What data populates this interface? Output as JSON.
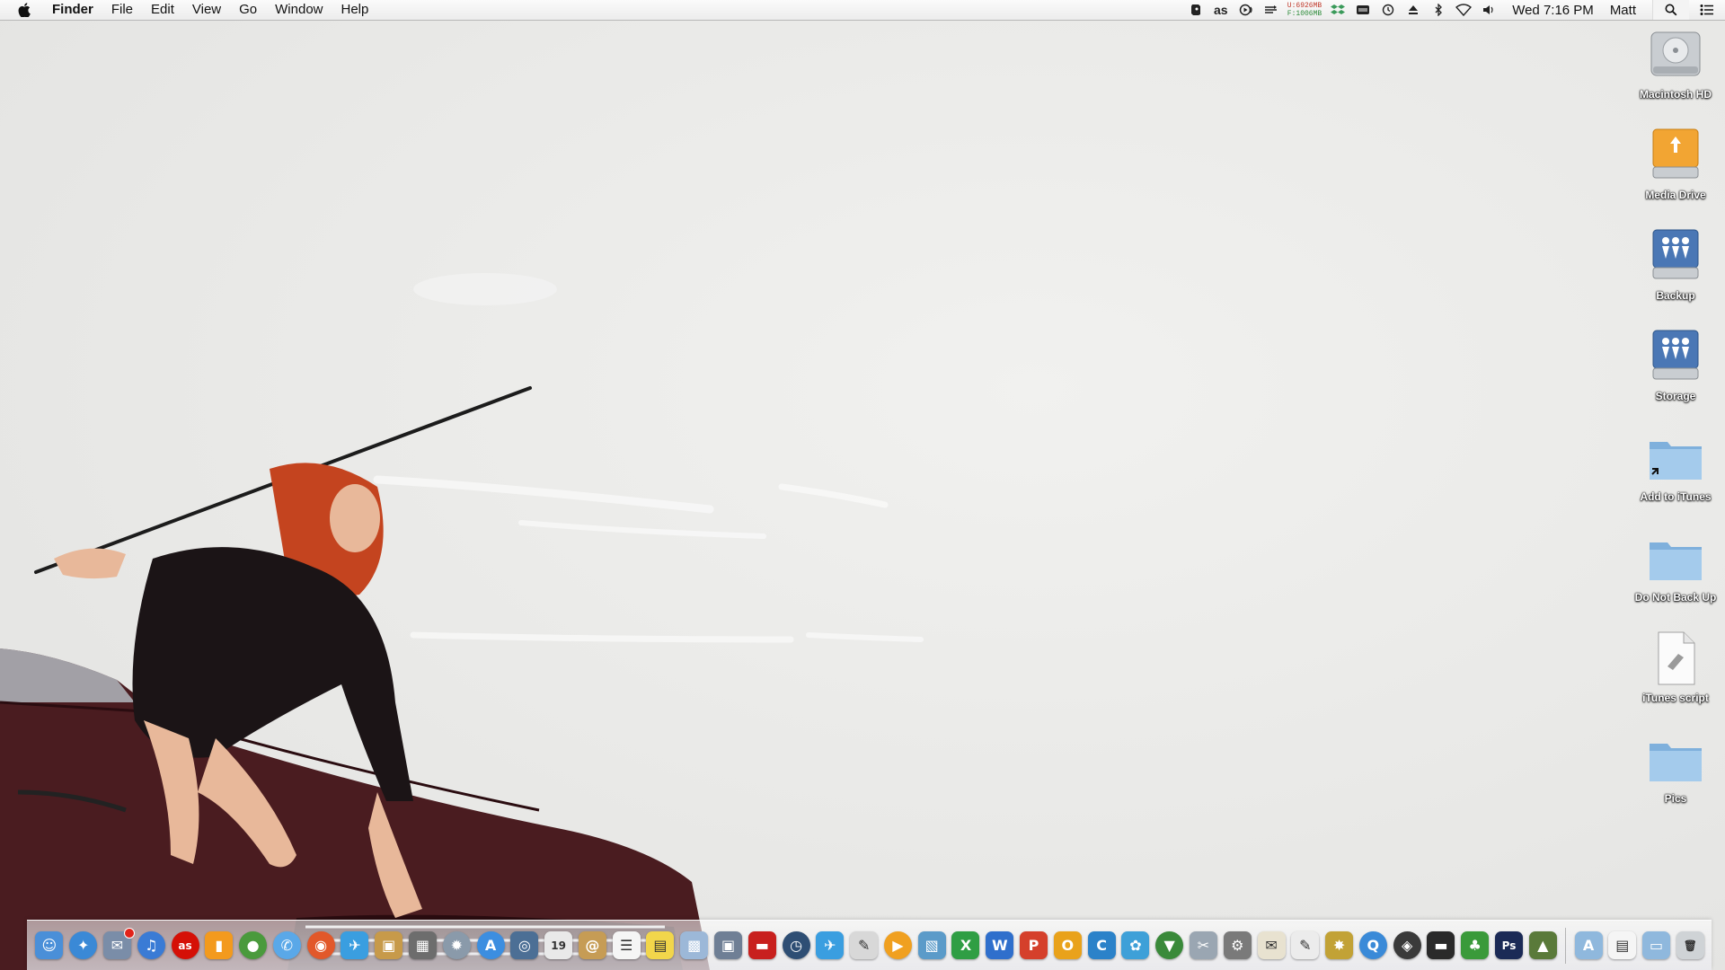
{
  "menubar": {
    "app_name": "Finder",
    "menus": [
      "File",
      "Edit",
      "View",
      "Go",
      "Window",
      "Help"
    ],
    "status": {
      "lastfm": "as",
      "memory_used": "U:6926MB",
      "memory_free": "F:1006MB",
      "clock": "Wed 7:16 PM",
      "user": "Matt"
    }
  },
  "desktop": {
    "icons": [
      {
        "label": "Macintosh HD",
        "icon": "hard-drive-icon"
      },
      {
        "label": "Media Drive",
        "icon": "firewire-drive-icon"
      },
      {
        "label": "Backup",
        "icon": "network-drive-icon"
      },
      {
        "label": "Storage",
        "icon": "network-drive-icon"
      },
      {
        "label": "Add to iTunes",
        "icon": "folder-alias-icon"
      },
      {
        "label": "Do Not Back Up",
        "icon": "folder-icon"
      },
      {
        "label": "iTunes script",
        "icon": "script-icon"
      },
      {
        "label": "Pics",
        "icon": "folder-icon"
      }
    ]
  },
  "dock": {
    "apps": [
      {
        "name": "finder",
        "glyph": "☺",
        "color": "#4a8fd8"
      },
      {
        "name": "safari",
        "glyph": "✦",
        "color": "#3a89d6",
        "round": true
      },
      {
        "name": "mail-stamp",
        "glyph": "✉",
        "color": "#7a8da8",
        "badge": true
      },
      {
        "name": "itunes",
        "glyph": "♫",
        "color": "#3a7bd5",
        "round": true
      },
      {
        "name": "lastfm",
        "glyph": "as",
        "color": "#d51007",
        "round": true
      },
      {
        "name": "ibooks",
        "glyph": "▮",
        "color": "#f39a1e"
      },
      {
        "name": "chrome",
        "glyph": "●",
        "color": "#4a9a3c",
        "round": true
      },
      {
        "name": "messages",
        "glyph": "✆",
        "color": "#5aa8e8",
        "round": true
      },
      {
        "name": "firefox",
        "glyph": "◉",
        "color": "#e2582a",
        "round": true
      },
      {
        "name": "twitter",
        "glyph": "✈",
        "color": "#3a9ee0"
      },
      {
        "name": "package",
        "glyph": "▣",
        "color": "#c79a4a"
      },
      {
        "name": "grid-app",
        "glyph": "▦",
        "color": "#6d6d6d"
      },
      {
        "name": "launchpad",
        "glyph": "✹",
        "color": "#8a9aaa",
        "round": true
      },
      {
        "name": "app-store",
        "glyph": "A",
        "color": "#3c8ee0",
        "round": true
      },
      {
        "name": "image-capture",
        "glyph": "◎",
        "color": "#4c6f95"
      },
      {
        "name": "calendar",
        "glyph": "19",
        "color": "#e9e9e9",
        "dark": true
      },
      {
        "name": "contacts",
        "glyph": "@",
        "color": "#c69c55"
      },
      {
        "name": "reminders",
        "glyph": "☰",
        "color": "#f5f5f5",
        "dark": true
      },
      {
        "name": "stickies",
        "glyph": "▤",
        "color": "#f2d64b",
        "dark": true
      },
      {
        "name": "preview",
        "glyph": "▩",
        "color": "#9cb8d8"
      },
      {
        "name": "photo-booth",
        "glyph": "▣",
        "color": "#6f7f95"
      },
      {
        "name": "flashcard",
        "glyph": "▬",
        "color": "#c8201e"
      },
      {
        "name": "time-machine",
        "glyph": "◷",
        "color": "#2e4e74",
        "round": true
      },
      {
        "name": "twitterrific",
        "glyph": "✈",
        "color": "#3a9ee0"
      },
      {
        "name": "script-editor",
        "glyph": "✎",
        "color": "#d8d8d8",
        "dark": true
      },
      {
        "name": "vlc",
        "glyph": "▶",
        "color": "#f0a020",
        "round": true
      },
      {
        "name": "preview-2",
        "glyph": "▧",
        "color": "#5b9bc9"
      },
      {
        "name": "excel",
        "glyph": "X",
        "color": "#2f9e44"
      },
      {
        "name": "word",
        "glyph": "W",
        "color": "#2f6fcc"
      },
      {
        "name": "powerpoint",
        "glyph": "P",
        "color": "#d5402b"
      },
      {
        "name": "outlook",
        "glyph": "O",
        "color": "#e9a21b"
      },
      {
        "name": "communicator",
        "glyph": "C",
        "color": "#2b82c9"
      },
      {
        "name": "messenger",
        "glyph": "✿",
        "color": "#3ea0d8"
      },
      {
        "name": "transmission",
        "glyph": "▼",
        "color": "#3a8a3a",
        "round": true
      },
      {
        "name": "utilities",
        "glyph": "✂",
        "color": "#9aa6b2"
      },
      {
        "name": "system-preferences",
        "glyph": "⚙",
        "color": "#7a7a7a"
      },
      {
        "name": "mail-relay",
        "glyph": "✉",
        "color": "#e8e2d0",
        "dark": true
      },
      {
        "name": "textedit",
        "glyph": "✎",
        "color": "#ececec",
        "dark": true
      },
      {
        "name": "pineapple",
        "glyph": "✸",
        "color": "#c2a236"
      },
      {
        "name": "quicktime",
        "glyph": "Q",
        "color": "#3a8ad8",
        "round": true
      },
      {
        "name": "dashboard",
        "glyph": "◈",
        "color": "#3a3a3a",
        "round": true
      },
      {
        "name": "ethernet",
        "glyph": "▬",
        "color": "#2a2a2a"
      },
      {
        "name": "evernote",
        "glyph": "♣",
        "color": "#3a9a3a"
      },
      {
        "name": "photoshop",
        "glyph": "Ps",
        "color": "#1b2a56"
      },
      {
        "name": "activity-monitor",
        "glyph": "▲",
        "color": "#5a7a3a"
      }
    ],
    "right": [
      {
        "name": "applications-folder",
        "glyph": "A",
        "color": "#8fb8dd"
      },
      {
        "name": "documents-stack",
        "glyph": "▤",
        "color": "#f5f5f5",
        "dark": true
      },
      {
        "name": "downloads-folder",
        "glyph": "▭",
        "color": "#8fb8dd"
      },
      {
        "name": "trash",
        "glyph": "🗑",
        "color": "#cfd3d6",
        "dark": true
      }
    ]
  },
  "colors": {
    "menubar_bg": "#f4f4f4",
    "wallpaper": "#e9e9e7",
    "car": "#4a1c20",
    "hair": "#c4441f",
    "folder_blue": "#8fb8dd"
  }
}
